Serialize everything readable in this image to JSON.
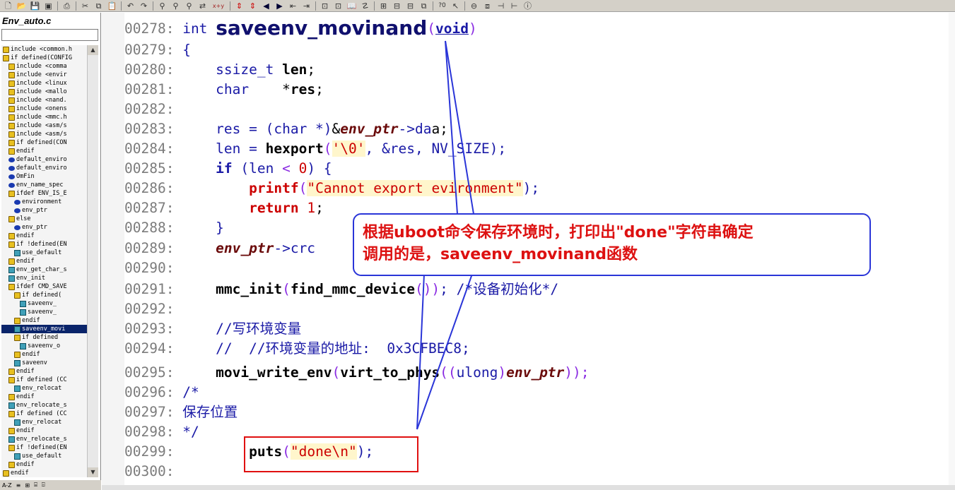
{
  "toolbar": {
    "icons": [
      "new-file-icon",
      "open-file-icon",
      "save-icon",
      "save-all-icon",
      "print-icon",
      "cut-icon",
      "copy-icon",
      "paste-icon",
      "undo-icon",
      "redo-icon",
      "find-icon",
      "find-next-icon",
      "find-prev-icon",
      "replace-icon",
      "xy-icon",
      "bookmark-toggle-icon",
      "bookmark-list-icon",
      "back-icon",
      "forward-icon",
      "jump-icon",
      "jump-def-icon",
      "symbol-window-icon",
      "book-icon",
      "project-icon",
      "layout-1-icon",
      "layout-2-icon",
      "layout-3-icon",
      "layout-4-icon",
      "help-context-icon",
      "help-cursor-icon",
      "sync-icon",
      "relation-icon",
      "browse-icon",
      "tree-icon",
      "info-icon"
    ],
    "glyph_xy": "x+y",
    "glyph_help": "?0"
  },
  "sidepanel": {
    "file_title": "Env_auto.c",
    "filter_value": "",
    "symbols": [
      {
        "kind": "def",
        "indent": 0,
        "text": "include <common.h"
      },
      {
        "kind": "def",
        "indent": 0,
        "text": "if defined(CONFIG"
      },
      {
        "kind": "def",
        "indent": 1,
        "text": "include <comma"
      },
      {
        "kind": "def",
        "indent": 1,
        "text": "include <envir"
      },
      {
        "kind": "def",
        "indent": 1,
        "text": "include <linux"
      },
      {
        "kind": "def",
        "indent": 1,
        "text": "include <mallo"
      },
      {
        "kind": "def",
        "indent": 1,
        "text": "include <nand."
      },
      {
        "kind": "def",
        "indent": 1,
        "text": "include <onens"
      },
      {
        "kind": "def",
        "indent": 1,
        "text": "include <mmc.h"
      },
      {
        "kind": "def",
        "indent": 1,
        "text": "include <asm/s"
      },
      {
        "kind": "def",
        "indent": 1,
        "text": "include <asm/s"
      },
      {
        "kind": "def",
        "indent": 1,
        "text": "if defined(CON"
      },
      {
        "kind": "def",
        "indent": 1,
        "text": "endif"
      },
      {
        "kind": "var",
        "indent": 1,
        "text": "default_enviro"
      },
      {
        "kind": "var",
        "indent": 1,
        "text": "default_enviro"
      },
      {
        "kind": "var",
        "indent": 1,
        "text": "OmFin"
      },
      {
        "kind": "var",
        "indent": 1,
        "text": "env_name_spec"
      },
      {
        "kind": "def",
        "indent": 1,
        "text": "ifdef ENV_IS_E"
      },
      {
        "kind": "var",
        "indent": 2,
        "text": "environment"
      },
      {
        "kind": "var",
        "indent": 2,
        "text": "env_ptr"
      },
      {
        "kind": "def",
        "indent": 1,
        "text": "else"
      },
      {
        "kind": "var",
        "indent": 2,
        "text": "env_ptr"
      },
      {
        "kind": "def",
        "indent": 1,
        "text": "endif"
      },
      {
        "kind": "def",
        "indent": 1,
        "text": "if !defined(EN"
      },
      {
        "kind": "fn",
        "indent": 2,
        "text": "use_default"
      },
      {
        "kind": "def",
        "indent": 1,
        "text": "endif"
      },
      {
        "kind": "fn",
        "indent": 1,
        "text": "env_get_char_s"
      },
      {
        "kind": "fn",
        "indent": 1,
        "text": "env_init"
      },
      {
        "kind": "def",
        "indent": 1,
        "text": "ifdef CMD_SAVE"
      },
      {
        "kind": "def",
        "indent": 2,
        "text": "if defined("
      },
      {
        "kind": "fn",
        "indent": 3,
        "text": "saveenv_"
      },
      {
        "kind": "fn",
        "indent": 3,
        "text": "saveenv_"
      },
      {
        "kind": "def",
        "indent": 2,
        "text": "endif"
      },
      {
        "kind": "fn",
        "indent": 2,
        "text": "saveenv_movi",
        "selected": true
      },
      {
        "kind": "def",
        "indent": 2,
        "text": "if defined"
      },
      {
        "kind": "fn",
        "indent": 3,
        "text": "saveenv_o"
      },
      {
        "kind": "def",
        "indent": 2,
        "text": "endif"
      },
      {
        "kind": "fn",
        "indent": 2,
        "text": "saveenv"
      },
      {
        "kind": "def",
        "indent": 1,
        "text": "endif"
      },
      {
        "kind": "def",
        "indent": 1,
        "text": "if defined (CC"
      },
      {
        "kind": "fn",
        "indent": 2,
        "text": "env_relocat"
      },
      {
        "kind": "def",
        "indent": 1,
        "text": "endif"
      },
      {
        "kind": "fn",
        "indent": 1,
        "text": "env_relocate_s"
      },
      {
        "kind": "def",
        "indent": 1,
        "text": "if defined (CC"
      },
      {
        "kind": "fn",
        "indent": 2,
        "text": "env_relocat"
      },
      {
        "kind": "def",
        "indent": 1,
        "text": "endif"
      },
      {
        "kind": "fn",
        "indent": 1,
        "text": "env_relocate_s"
      },
      {
        "kind": "def",
        "indent": 1,
        "text": "if !defined(EN"
      },
      {
        "kind": "fn",
        "indent": 2,
        "text": "use_default"
      },
      {
        "kind": "def",
        "indent": 1,
        "text": "endif"
      },
      {
        "kind": "def",
        "indent": 0,
        "text": "endif"
      }
    ],
    "tabs": [
      "A-Z",
      "≡",
      "⊞",
      "⌸",
      "⌹"
    ]
  },
  "code": {
    "l278": {
      "ln": "00278:",
      "kw": "int",
      "fn": "saveenv_movinand",
      "open": "(",
      "arg": "void",
      "close": ")"
    },
    "l279": {
      "ln": "00279:",
      "text": "{"
    },
    "l280": {
      "ln": "00280:",
      "type": "ssize_t",
      "var": "len",
      "semi": ";"
    },
    "l281": {
      "ln": "00281:",
      "type": "char",
      "ptr": "*",
      "var": "res",
      "semi": ";"
    },
    "l282": {
      "ln": "00282:"
    },
    "l283": {
      "ln": "00283:",
      "a": "res = ",
      "b": "(char *)",
      "c": "&",
      "d": "env_ptr",
      "e": "->",
      "f": "da",
      "g": "a;"
    },
    "l284": {
      "ln": "00284:",
      "a": "len = ",
      "fn": "hexport",
      "b": "(",
      "str": "'\\0'",
      "c": ", &res, ",
      "d": "NV_SIZE",
      ")": ");"
    },
    "l285": {
      "ln": "00285:",
      "kw": "if",
      "a": " (len ",
      "op": "<",
      "b": " 0",
      ")": ") {"
    },
    "l286": {
      "ln": "00286:",
      "fn": "printf",
      "str": "\"Cannot export ",
      "mid": "e",
      "str2": "vironment\"",
      "end": ");"
    },
    "l287": {
      "ln": "00287:",
      "kw": "return",
      "num": " 1",
      "semi": ";"
    },
    "l288": {
      "ln": "00288:",
      "text": "}"
    },
    "l289": {
      "ln": "00289:",
      "var": "env_ptr",
      "arrow": "->",
      "f": "crc"
    },
    "l290": {
      "ln": "00290:"
    },
    "l291": {
      "ln": "00291:",
      "fn": "mmc_init",
      "a": "(",
      "fn2": "find_mmc_device",
      "b": "(",
      "c": "))",
      "d": "; ",
      "cmt": "/*设备初始化*/"
    },
    "l292": {
      "ln": "00292:"
    },
    "l293": {
      "ln": "00293:",
      "cmt": "//写环境变量"
    },
    "l294": {
      "ln": "00294:",
      "cmt": "//  //环境变量的地址:  0x",
      "cmt2": "3CFBEC8;"
    },
    "l295": {
      "ln": "00295:",
      "fn": "movi_write_env",
      "a": "(",
      "fn2": "virt_to",
      "b": "_phys",
      "c": "((",
      "t": "ulong",
      ")": ")",
      "var": "env_ptr",
      "end": "));"
    },
    "l296": {
      "ln": "00296:",
      "cmt": "/*"
    },
    "l297": {
      "ln": "00297:",
      "cmt": "保存位置"
    },
    "l298": {
      "ln": "00298:",
      "cmt": "*/"
    },
    "l299": {
      "ln": "00299:",
      "fn": "puts",
      "a": "(",
      "str": "\"done\\n\"",
      "end": ");"
    },
    "l300": {
      "ln": "00300:"
    }
  },
  "annotation": {
    "line1_a": "根据",
    "line1_b": "uboot",
    "line1_c": "命令保存环境时，打印出",
    "line1_d": "\"done\"",
    "line1_e": "字符串确定",
    "line2_a": "调用的是，",
    "line2_b": "saveenv_movinand",
    "line2_c": "函数",
    "border_color": "#2a35d8",
    "text_color": "#dd1111",
    "highlight_box_color": "#e01010"
  }
}
